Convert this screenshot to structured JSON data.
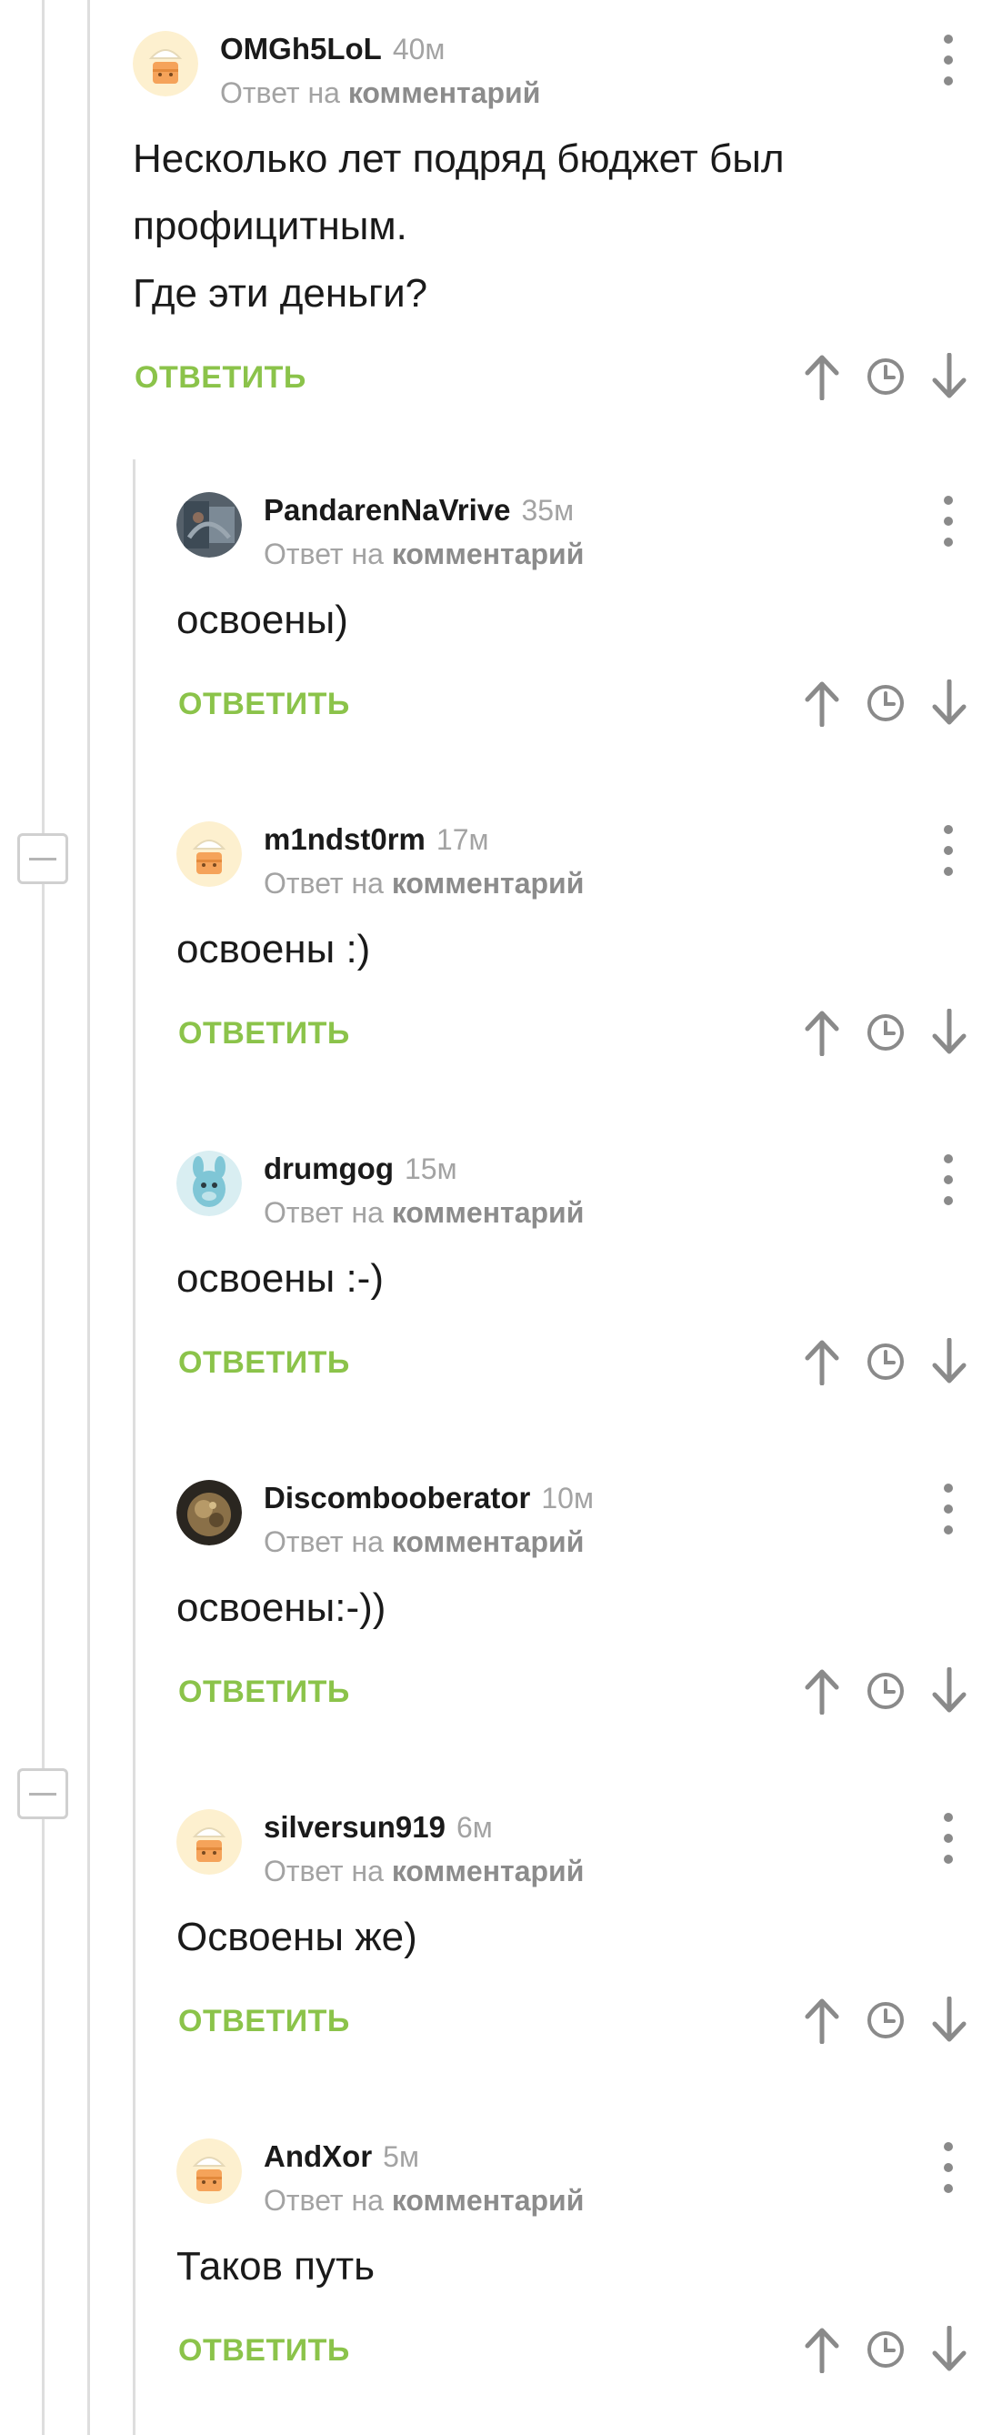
{
  "comments": [
    {
      "username": "OMGh5LoL",
      "time": "40м",
      "reply_to_prefix": "Ответ на",
      "reply_to_link": "комментарий",
      "body": [
        "Несколько лет подряд бюджет был профицитным.",
        "Где эти деньги?"
      ],
      "reply_label": "ОТВЕТИТЬ",
      "avatar": "cake-avatar"
    },
    {
      "username": "PandarenNaVrive",
      "time": "35м",
      "reply_to_prefix": "Ответ на",
      "reply_to_link": "комментарий",
      "body": [
        "освоены)"
      ],
      "reply_label": "ОТВЕТИТЬ",
      "avatar": "photo-avatar"
    },
    {
      "username": "m1ndst0rm",
      "time": "17м",
      "reply_to_prefix": "Ответ на",
      "reply_to_link": "комментарий",
      "body": [
        "освоены :)"
      ],
      "reply_label": "ОТВЕТИТЬ",
      "avatar": "cake-avatar"
    },
    {
      "username": "drumgog",
      "time": "15м",
      "reply_to_prefix": "Ответ на",
      "reply_to_link": "комментарий",
      "body": [
        "освоены :-)"
      ],
      "reply_label": "ОТВЕТИТЬ",
      "avatar": "toy-avatar"
    },
    {
      "username": "Discombooberator",
      "time": "10м",
      "reply_to_prefix": "Ответ на",
      "reply_to_link": "комментарий",
      "body": [
        "освоены:-))"
      ],
      "reply_label": "ОТВЕТИТЬ",
      "avatar": "photo-avatar"
    },
    {
      "username": "silversun919",
      "time": "6м",
      "reply_to_prefix": "Ответ на",
      "reply_to_link": "комментарий",
      "body": [
        "Освоены же)"
      ],
      "reply_label": "ОТВЕТИТЬ",
      "avatar": "cake-avatar"
    },
    {
      "username": "AndXor",
      "time": "5м",
      "reply_to_prefix": "Ответ на",
      "reply_to_link": "комментарий",
      "body": [
        "Таков путь"
      ],
      "reply_label": "ОТВЕТИТЬ",
      "avatar": "cake-avatar"
    }
  ],
  "icons": {
    "upvote": "arrow-up-icon",
    "save": "clock-icon",
    "downvote": "arrow-down-icon",
    "more": "more-vertical-icon",
    "collapse": "minus-icon"
  },
  "colors": {
    "reply_accent": "#8bc34a",
    "meta_gray": "#a3a3a3",
    "icon_gray": "#8a8a8a",
    "thread_line": "#dedede"
  }
}
